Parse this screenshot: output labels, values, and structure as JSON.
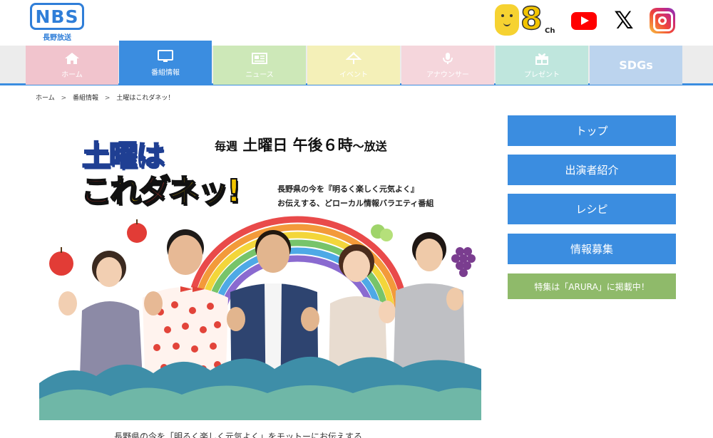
{
  "header": {
    "logo_text": "NBS",
    "logo_subtext": "長野放送",
    "channel_number": "8",
    "channel_suffix": "Ch",
    "x_icon_glyph": "𝕏",
    "sns_icons": [
      "youtube-icon",
      "x-icon",
      "instagram-icon"
    ]
  },
  "nav": {
    "items": [
      {
        "label": "ホーム",
        "icon": "home-icon",
        "color": "#f1c4cd"
      },
      {
        "label": "番組情報",
        "icon": "tv-icon",
        "color": "#3b8de0",
        "active": true
      },
      {
        "label": "ニュース",
        "icon": "newspaper-icon",
        "color": "#cde8b8"
      },
      {
        "label": "イベント",
        "icon": "event-icon",
        "color": "#f4f0b8"
      },
      {
        "label": "アナウンサー",
        "icon": "microphone-icon",
        "color": "#f5d6dc"
      },
      {
        "label": "プレゼント",
        "icon": "gift-icon",
        "color": "#bfe6dd"
      },
      {
        "label": "SDGs",
        "icon": "",
        "color": "#bcd4ee"
      }
    ],
    "accent": "#3b8de0"
  },
  "breadcrumb": {
    "items": [
      "ホーム",
      "番組情報",
      "土曜はこれダネッ！"
    ],
    "separator": ">"
  },
  "hero": {
    "title_line1": "土曜は",
    "title_line2_parts": [
      "こ",
      "れ",
      "ダ",
      "ネッ!"
    ],
    "schedule_prefix": "毎週",
    "schedule_main": "土曜日 午後６時",
    "schedule_suffix": "〜放送",
    "tagline_line1": "長野県の今を『明るく楽しく元気よく』",
    "tagline_line2": "お伝えする、どローカル情報バラエティ番組"
  },
  "intro_text": "長野県の今を「明るく楽しく元気よく」をモットーにお伝えする",
  "sidebar": {
    "buttons": [
      {
        "label": "トップ",
        "name": "sidebar-top-button"
      },
      {
        "label": "出演者紹介",
        "name": "sidebar-cast-button"
      },
      {
        "label": "レシピ",
        "name": "sidebar-recipe-button"
      },
      {
        "label": "情報募集",
        "name": "sidebar-info-button"
      }
    ],
    "feature_label": "特集は「ARURA」に掲載中！",
    "button_color": "#3b8de0",
    "feature_color": "#8fba6a"
  }
}
